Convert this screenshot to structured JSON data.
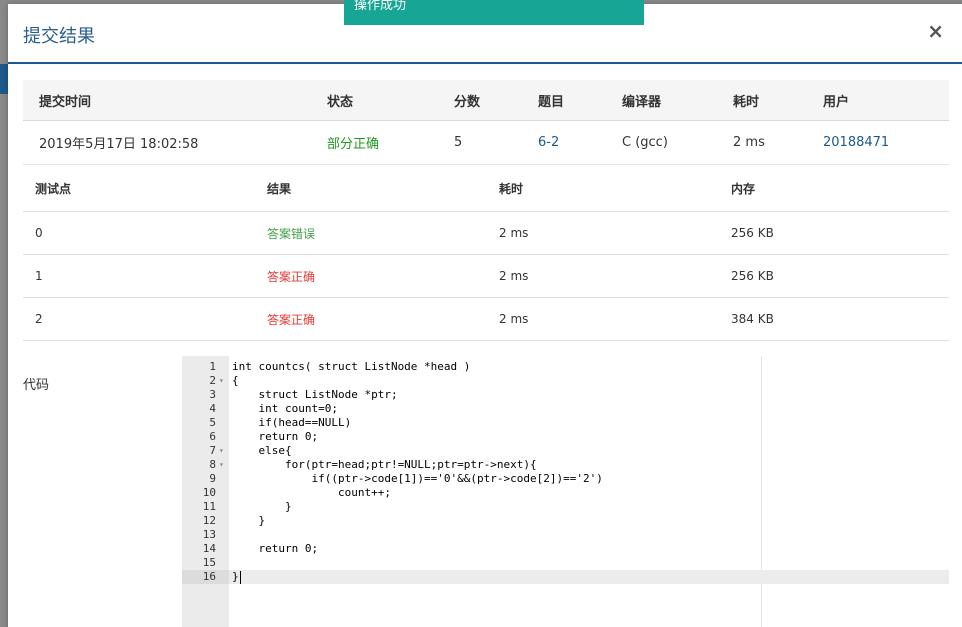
{
  "modal": {
    "title": "提交结果",
    "close_symbol": "×"
  },
  "toast": {
    "message": "操作成功",
    "color": "#17a696"
  },
  "summary": {
    "headers": [
      "提交时间",
      "状态",
      "分数",
      "题目",
      "编译器",
      "耗时",
      "用户"
    ],
    "row": {
      "time": "2019年5月17日 18:02:58",
      "status": "部分正确",
      "score": "5",
      "problem": "6-2",
      "compiler": "C (gcc)",
      "duration": "2 ms",
      "user": "20188471"
    }
  },
  "cases": {
    "headers": [
      "测试点",
      "结果",
      "耗时",
      "内存"
    ],
    "rows": [
      {
        "id": "0",
        "result": "答案错误",
        "time": "2 ms",
        "memory": "256 KB"
      },
      {
        "id": "1",
        "result": "答案正确",
        "time": "2 ms",
        "memory": "256 KB"
      },
      {
        "id": "2",
        "result": "答案正确",
        "time": "2 ms",
        "memory": "384 KB"
      }
    ]
  },
  "code": {
    "label": "代码",
    "lines": [
      {
        "n": "1",
        "text": "int countcs( struct ListNode *head )"
      },
      {
        "n": "2",
        "text": "{"
      },
      {
        "n": "3",
        "text": "    struct ListNode *ptr;"
      },
      {
        "n": "4",
        "text": "    int count=0;"
      },
      {
        "n": "5",
        "text": "    if(head==NULL)"
      },
      {
        "n": "6",
        "text": "    return 0;"
      },
      {
        "n": "7",
        "text": "    else{"
      },
      {
        "n": "8",
        "text": "        for(ptr=head;ptr!=NULL;ptr=ptr->next){"
      },
      {
        "n": "9",
        "text": "            if((ptr->code[1])=='0'&&(ptr->code[2])=='2')"
      },
      {
        "n": "10",
        "text": "                count++;"
      },
      {
        "n": "11",
        "text": "        }"
      },
      {
        "n": "12",
        "text": "    }"
      },
      {
        "n": "13",
        "text": ""
      },
      {
        "n": "14",
        "text": "    return 0;"
      },
      {
        "n": "15",
        "text": ""
      },
      {
        "n": "16",
        "text": "}"
      }
    ]
  }
}
